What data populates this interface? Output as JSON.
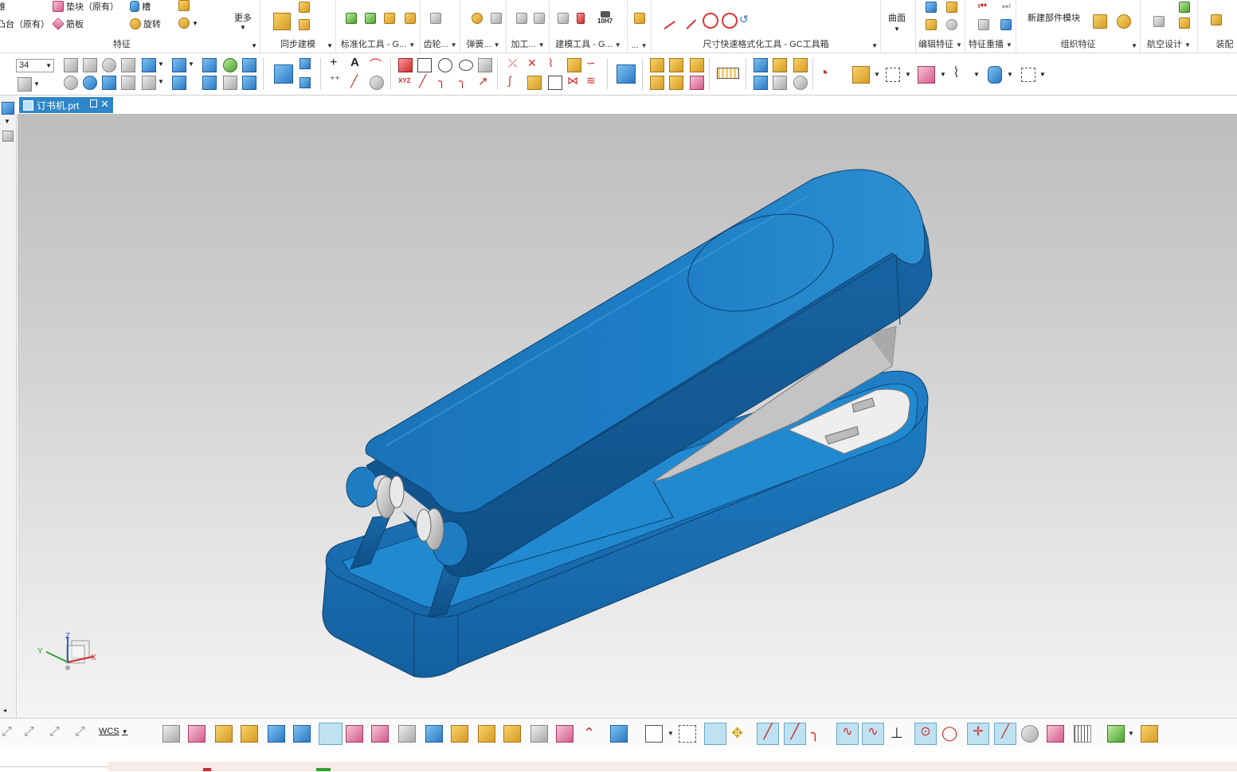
{
  "window": {
    "part_file": "订书机.prt"
  },
  "ribbon": {
    "feature_group": {
      "label": "特征",
      "items": [
        {
          "label": "锥"
        },
        {
          "label": "垫块（原有）"
        },
        {
          "label": "槽"
        },
        {
          "label": "凸台（原有）"
        },
        {
          "label": "筋板"
        },
        {
          "label": "旋转"
        }
      ],
      "more_label": "更多"
    },
    "groups": [
      {
        "label": "同步建模"
      },
      {
        "label": "标准化工具 - G..."
      },
      {
        "label": "齿轮..."
      },
      {
        "label": "弹簧..."
      },
      {
        "label": "加工..."
      },
      {
        "label": "建模工具 - G..."
      },
      {
        "label": "..."
      },
      {
        "label": "尺寸快速格式化工具 - GC工具箱"
      },
      {
        "label": "编辑特征"
      },
      {
        "label": "特征重播"
      },
      {
        "label": "组织特征"
      },
      {
        "label": "航空设计"
      },
      {
        "label": "装配"
      }
    ],
    "surface_label": "曲面",
    "tolerance_label": "10H7",
    "new_component_label": "新建部件模块"
  },
  "toolbar2": {
    "zoom_value": "34"
  },
  "bottom_toolbar": {
    "wcs_label": "WCS"
  },
  "triad": {
    "x": "X",
    "y": "Y",
    "z": "Z"
  },
  "colors": {
    "accent": "#2e86c8",
    "model_blue": "#1b75bb",
    "viewport_top": "#bdbdbd",
    "viewport_bottom": "#f4f4f4"
  }
}
